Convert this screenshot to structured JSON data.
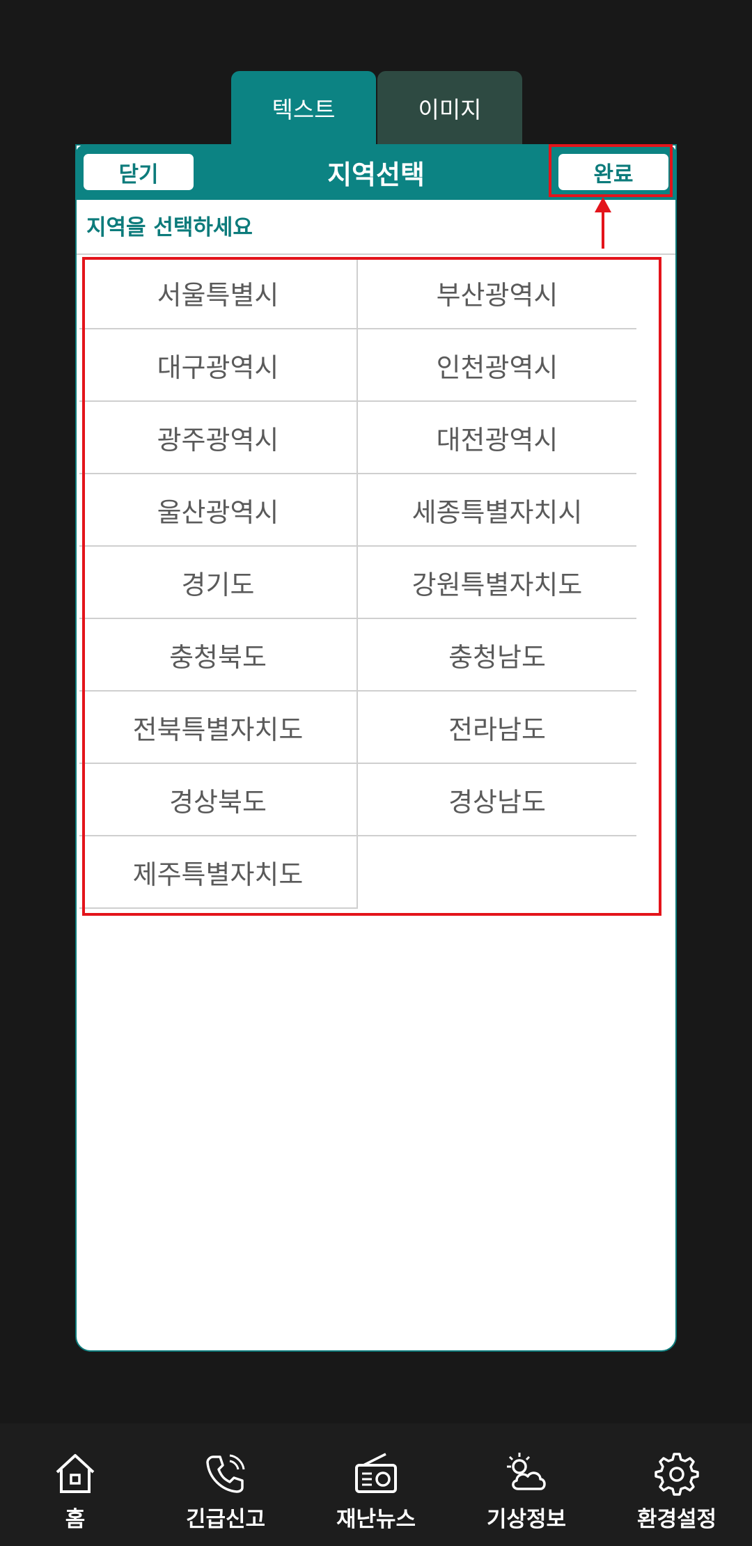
{
  "tabs": {
    "text_label": "텍스트",
    "image_label": "이미지"
  },
  "header": {
    "close_label": "닫기",
    "title": "지역선택",
    "done_label": "완료"
  },
  "subtitle": "지역을 선택하세요",
  "regions": [
    "서울특별시",
    "부산광역시",
    "대구광역시",
    "인천광역시",
    "광주광역시",
    "대전광역시",
    "울산광역시",
    "세종특별자치시",
    "경기도",
    "강원특별자치도",
    "충청북도",
    "충청남도",
    "전북특별자치도",
    "전라남도",
    "경상북도",
    "경상남도",
    "제주특별자치도"
  ],
  "bottom_nav": [
    {
      "label": "홈",
      "icon": "home-icon"
    },
    {
      "label": "긴급신고",
      "icon": "phone-icon"
    },
    {
      "label": "재난뉴스",
      "icon": "radio-icon"
    },
    {
      "label": "기상정보",
      "icon": "weather-icon"
    },
    {
      "label": "환경설정",
      "icon": "gear-icon"
    }
  ],
  "colors": {
    "accent": "#0c8383",
    "highlight": "#e3141b",
    "background": "#181818"
  }
}
